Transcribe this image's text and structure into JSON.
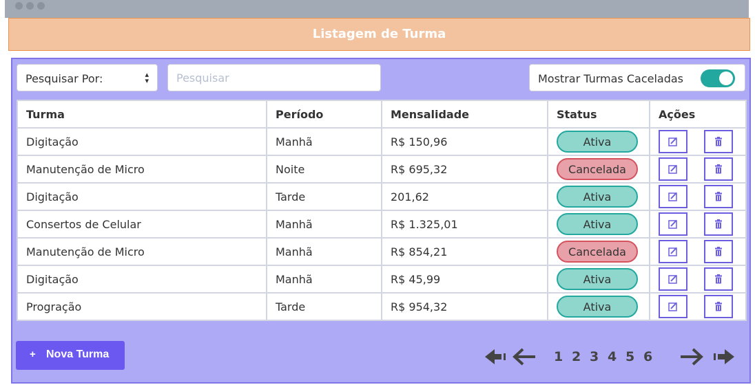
{
  "header": {
    "title": "Listagem de Turma"
  },
  "filters": {
    "search_by_label": "Pesquisar Por:",
    "search_placeholder": "Pesquisar",
    "show_cancelled_label": "Mostrar Turmas Caceladas",
    "show_cancelled_on": true
  },
  "table": {
    "columns": [
      "Turma",
      "Período",
      "Mensalidade",
      "Status",
      "Ações"
    ],
    "rows": [
      {
        "turma": "Digitação",
        "periodo": "Manhã",
        "mensalidade": "R$ 150,96",
        "status": "Ativa"
      },
      {
        "turma": "Manutenção de Micro",
        "periodo": "Noite",
        "mensalidade": "R$ 695,32",
        "status": "Cancelada"
      },
      {
        "turma": "Digitação",
        "periodo": "Tarde",
        "mensalidade": "201,62",
        "status": "Ativa"
      },
      {
        "turma": "Consertos de Celular",
        "periodo": "Manhã",
        "mensalidade": "R$ 1.325,01",
        "status": "Ativa"
      },
      {
        "turma": "Manutenção de Micro",
        "periodo": "Manhã",
        "mensalidade": "R$ 854,21",
        "status": "Cancelada"
      },
      {
        "turma": "Digitação",
        "periodo": "Manhã",
        "mensalidade": "R$ 45,99",
        "status": "Ativa"
      },
      {
        "turma": "Progração",
        "periodo": "Tarde",
        "mensalidade": "R$ 954,32",
        "status": "Ativa"
      }
    ]
  },
  "footer": {
    "new_button_icon": "+",
    "new_button_label": "Nova Turma",
    "pages": [
      "1",
      "2",
      "3",
      "4",
      "5",
      "6"
    ]
  },
  "icons": {
    "edit": "edit-icon",
    "delete": "trash-icon",
    "first": "first-page-icon",
    "prev": "arrow-left-icon",
    "next": "arrow-right-icon",
    "last": "last-page-icon"
  },
  "colors": {
    "header_bg": "#f3c29e",
    "panel_bg": "#afaaf6",
    "accent": "#6a58f0",
    "active_badge": "#8fd6cd",
    "cancelled_badge": "#e8a1a9",
    "toggle_on": "#22a89e"
  }
}
